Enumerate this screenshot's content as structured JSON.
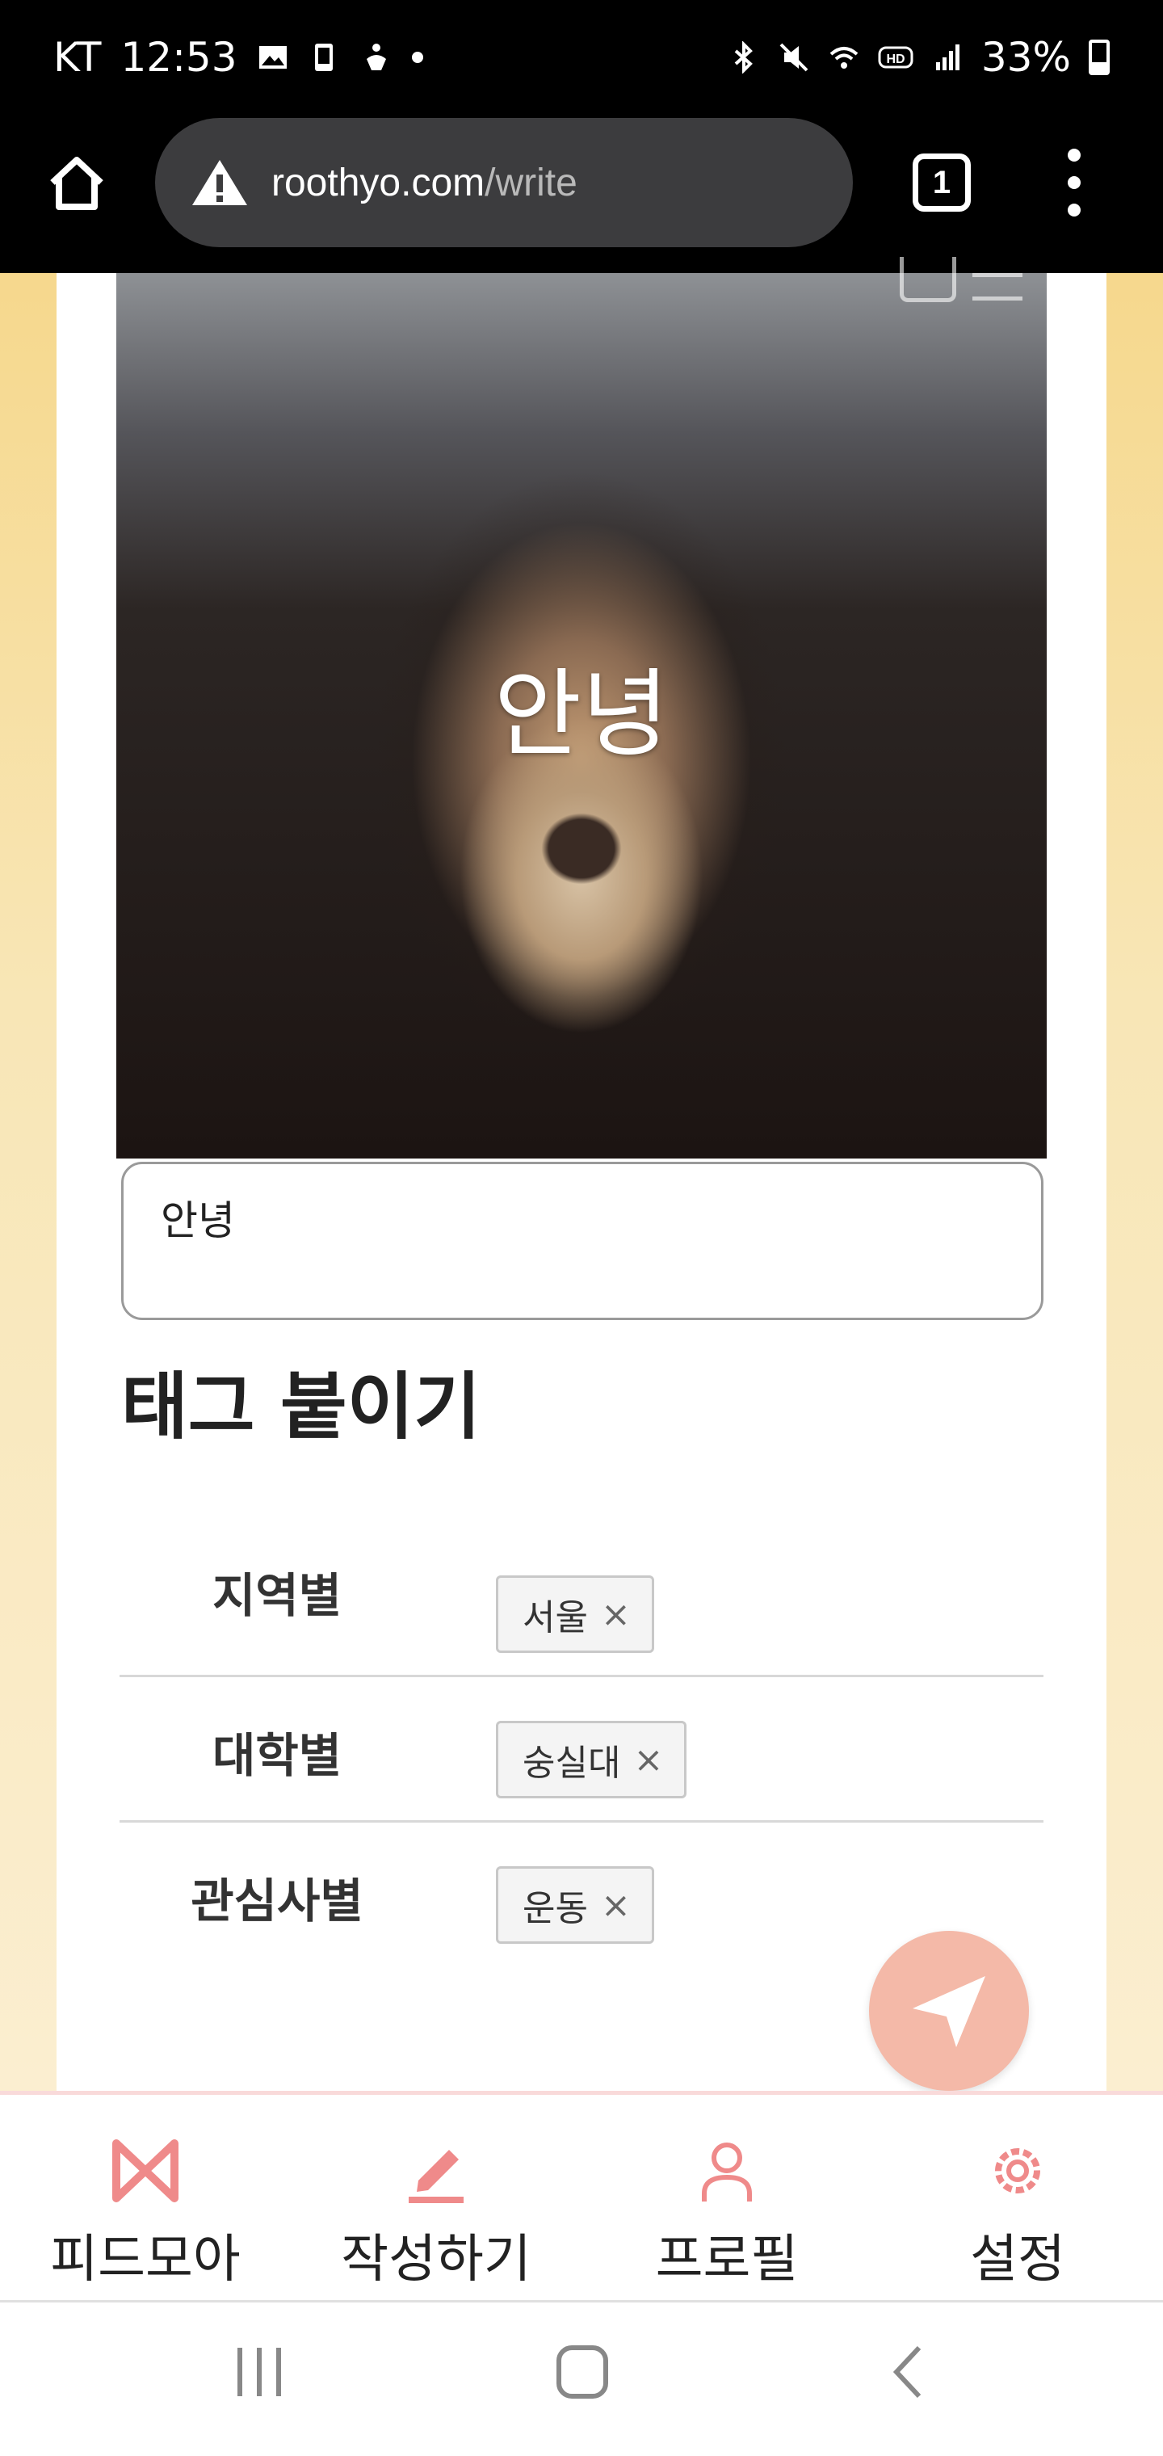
{
  "status_bar": {
    "carrier": "KT",
    "time": "12:53",
    "battery": "33%",
    "icons": [
      "gallery-icon",
      "screen-share-icon",
      "accessibility-icon",
      "bluetooth-icon",
      "mute-icon",
      "wifi-icon",
      "hd-voice-icon",
      "signal-icon"
    ]
  },
  "browser": {
    "url_domain": "roothyo.com",
    "url_path": "/write",
    "tab_count": "1"
  },
  "post": {
    "photo_caption": "안녕",
    "caption_value": "안녕"
  },
  "tags": {
    "title": "태그 붙이기",
    "rows": [
      {
        "label": "지역별",
        "chip": "서울"
      },
      {
        "label": "대학별",
        "chip": "숭실대"
      },
      {
        "label": "관심사별",
        "chip": "운동"
      }
    ],
    "remove_symbol": "×"
  },
  "bottom_nav": {
    "items": [
      {
        "label": "피드모아",
        "icon": "bowtie-icon"
      },
      {
        "label": "작성하기",
        "icon": "pencil-icon"
      },
      {
        "label": "프로필",
        "icon": "person-icon"
      },
      {
        "label": "설정",
        "icon": "gear-icon"
      }
    ],
    "accent_color": "#f08080"
  },
  "colors": {
    "background": "#f7d98e",
    "fab": "#f4b9a8"
  }
}
